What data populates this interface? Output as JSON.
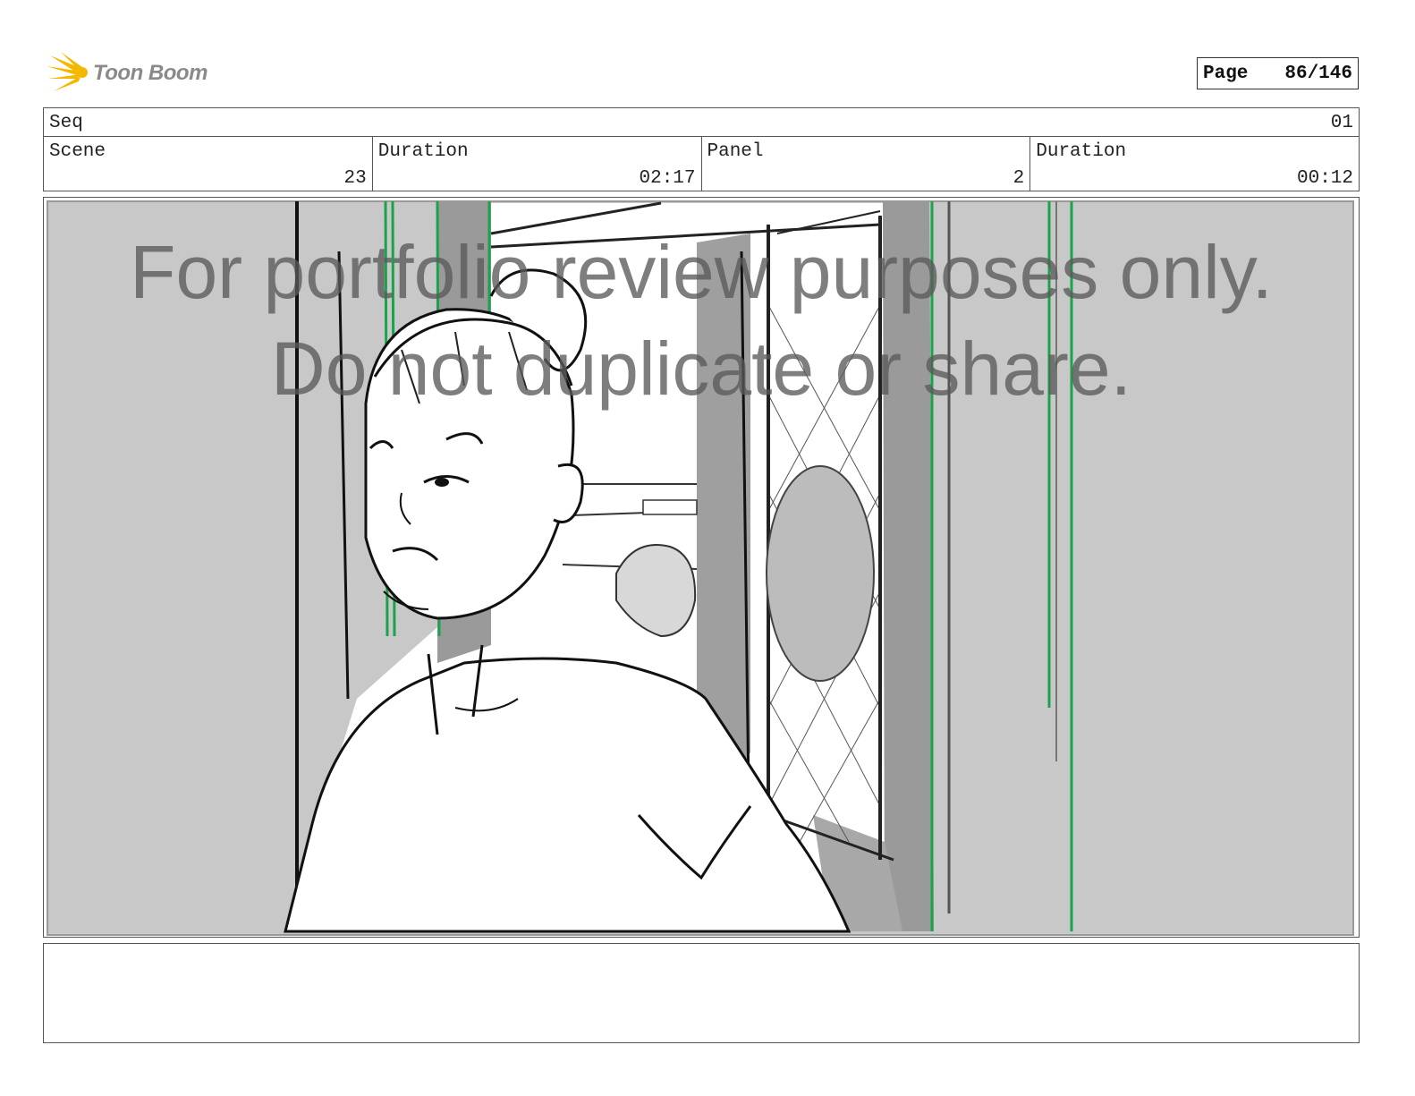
{
  "brand": {
    "logo_text": "Toon Boom",
    "accent_color": "#f5b800"
  },
  "page_indicator": {
    "label": "Page",
    "value": "86/146"
  },
  "sequence": {
    "label": "Seq",
    "value": "01"
  },
  "scene": {
    "label": "Scene",
    "value": "23"
  },
  "scene_duration": {
    "label": "Duration",
    "value": "02:17"
  },
  "panel": {
    "label": "Panel",
    "value": "2"
  },
  "panel_duration": {
    "label": "Duration",
    "value": "00:12"
  },
  "watermark": {
    "line1": "For portfolio review purposes only.",
    "line2": "Do not duplicate or share."
  },
  "sketch": {
    "subject": "storyboard sketch of a woman with hair bun looking over her shoulder inside a train car",
    "guide_color": "#1aa34a",
    "overlay_color": "#c8c8c8"
  },
  "notes": {
    "text": ""
  }
}
